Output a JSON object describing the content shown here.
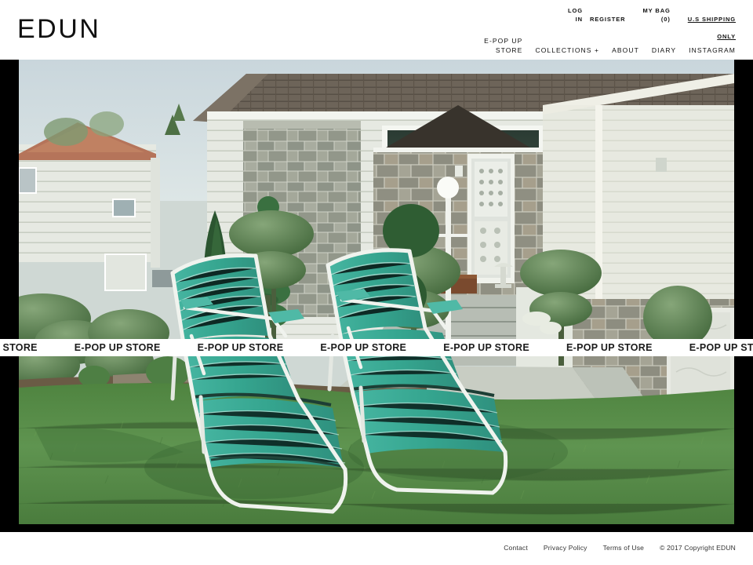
{
  "site": {
    "logo": "EDUN"
  },
  "utility_nav": {
    "login": "LOG\nIN",
    "register": "REGISTER",
    "bag": "MY BAG\n(0)",
    "shipping_line1": "U.S SHIPPING",
    "shipping_line2": "ONLY"
  },
  "main_nav": {
    "items": [
      {
        "label": "E-POP UP\nSTORE"
      },
      {
        "label": "COLLECTIONS +"
      },
      {
        "label": "ABOUT"
      },
      {
        "label": "DIARY"
      },
      {
        "label": "INSTAGRAM"
      }
    ]
  },
  "marquee": {
    "text": "E-POP UP STORE",
    "repeat": 8
  },
  "hero": {
    "alt": "Two vintage teal webbed lounge chairs on a suburban front lawn with topiary shrubs and a stone-faced ranch house",
    "colors": {
      "sky": "#ced9dd",
      "grass": "#5b8f48",
      "chair_webbing": "#3fae9a",
      "house_siding": "#e3e7e2",
      "stone": "#9a9e92",
      "roof": "#6b6158",
      "hedge_dark": "#2f5c33"
    }
  },
  "footer": {
    "links": [
      {
        "label": "Contact"
      },
      {
        "label": "Privacy Policy"
      },
      {
        "label": "Terms of Use"
      }
    ],
    "copyright": "© 2017 Copyright EDUN"
  }
}
